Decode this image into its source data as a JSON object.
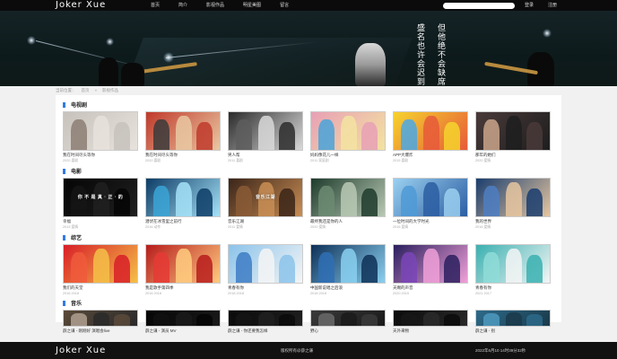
{
  "header": {
    "logo": "Joker Xue",
    "nav": [
      "首页",
      "简介",
      "影视作品",
      "明星美图",
      "留言"
    ],
    "search_placeholder": "",
    "login": "登录",
    "register": "注册"
  },
  "banner": {
    "poem_right": [
      "但",
      "他",
      "都",
      "不",
      "会",
      "缺",
      "席"
    ],
    "poem_columns": [
      "但他绝不会缺席",
      "盛名也许会迟到"
    ]
  },
  "breadcrumb": [
    "当前位置：",
    "首页",
    "»",
    "影视作品"
  ],
  "sections": [
    {
      "title": "电视剧",
      "items": [
        {
          "title": "我在时间尽头等你",
          "meta": "2020    喜剧",
          "colors": [
            "#c7c2bc",
            "#8c7e74",
            "#e7e2dc"
          ],
          "cap": ""
        },
        {
          "title": "我在时间尽头等你",
          "meta": "2020    喜剧",
          "colors": [
            "#c0392b",
            "#3b3b3b",
            "#e9c8a2"
          ],
          "cap": ""
        },
        {
          "title": "男人帮",
          "meta": "2011    喜剧",
          "colors": [
            "#2b2b2b",
            "#5d5d5d",
            "#d9d9d9"
          ],
          "cap": ""
        },
        {
          "title": "妈妈像花儿一样",
          "meta": "2011    家庭剧",
          "colors": [
            "#e8a0b5",
            "#4aa3d9",
            "#f3e3a1"
          ],
          "cap": ""
        },
        {
          "title": "APP大爆炸",
          "meta": "2015    喜剧",
          "colors": [
            "#f6d32d",
            "#4aa8e6",
            "#e65a3a"
          ],
          "cap": ""
        },
        {
          "title": "那年的她们",
          "meta": "2020    爱情",
          "colors": [
            "#4a3a3a",
            "#caa58a",
            "#1e1e1e"
          ],
          "cap": ""
        }
      ]
    },
    {
      "title": "电影",
      "items": [
        {
          "title": "幸福",
          "meta": "2013    爱情",
          "colors": [
            "#050505",
            "#151515",
            "#202020"
          ],
          "cap": "你 不 是 真 · 正 · 的"
        },
        {
          "title": "潜伏在冰雪里之前行",
          "meta": "2016    动作",
          "colors": [
            "#0d3c66",
            "#3aa4d6",
            "#a5e2f7"
          ],
          "cap": ""
        },
        {
          "title": "音乐江湖",
          "meta": "2011    爱情",
          "colors": [
            "#3a2418",
            "#8a5a36",
            "#c98e55"
          ],
          "cap": "音乐江湖"
        },
        {
          "title": "最终我还是你的人",
          "meta": "2020    爱情",
          "colors": [
            "#1e3b2c",
            "#6c8b72",
            "#b8c9b4"
          ],
          "cap": ""
        },
        {
          "title": "一位时间的大学时光",
          "meta": "2016    爱情",
          "colors": [
            "#9bd0f0",
            "#4d9ad6",
            "#2b5ea2"
          ],
          "cap": ""
        },
        {
          "title": "我的世界",
          "meta": "2016    爱情",
          "colors": [
            "#1a3d6e",
            "#4e7ec2",
            "#e6c6a0"
          ],
          "cap": ""
        }
      ]
    },
    {
      "title": "综艺",
      "items": [
        {
          "title": "我们的天堂",
          "meta": "2016    2018",
          "colors": [
            "#d81e28",
            "#f05a3c",
            "#f4c048"
          ],
          "cap": ""
        },
        {
          "title": "我是歌手第四季",
          "meta": "2016    2018",
          "colors": [
            "#b71c1c",
            "#e53935",
            "#ffcc80"
          ],
          "cap": ""
        },
        {
          "title": "青春有你",
          "meta": "2018    2018",
          "colors": [
            "#8bc3ea",
            "#3d7cc4",
            "#f5f5f5"
          ],
          "cap": ""
        },
        {
          "title": "中国新说唱之后浪",
          "meta": "2018    2018",
          "colors": [
            "#0e3057",
            "#2f6fb5",
            "#8ad0f0"
          ],
          "cap": ""
        },
        {
          "title": "天赐的声音",
          "meta": "2020    2015",
          "colors": [
            "#2a1f5e",
            "#7a45b8",
            "#f0a0d8"
          ],
          "cap": ""
        },
        {
          "title": "青春有你",
          "meta": "2021    2017",
          "colors": [
            "#3ab0b0",
            "#8fdcd8",
            "#f5f5f5"
          ],
          "cap": ""
        }
      ]
    },
    {
      "title": "音乐",
      "items": [
        {
          "title": "薛之谦 - 刚刚好 演唱会live",
          "meta": "",
          "colors": [
            "#5a4a3a",
            "#b0a090",
            "#2a2a2a"
          ],
          "cap": ""
        },
        {
          "title": "薛之谦 - 演员 MV",
          "meta": "",
          "colors": [
            "#050505",
            "#101010",
            "#1a1a1a"
          ],
          "cap": ""
        },
        {
          "title": "薛之谦 - 你还要我怎样",
          "meta": "",
          "colors": [
            "#0a0a0a",
            "#151515",
            "#202020"
          ],
          "cap": ""
        },
        {
          "title": "野心",
          "meta": "",
          "colors": [
            "#3a3a3a",
            "#6a6a6a",
            "#1a1a1a"
          ],
          "cap": ""
        },
        {
          "title": "天外来物",
          "meta": "",
          "colors": [
            "#0a0a0a",
            "#181818",
            "#2a2a2a"
          ],
          "cap": ""
        },
        {
          "title": "薛之谦 - 别",
          "meta": "",
          "colors": [
            "#2d6a8a",
            "#4d9ac0",
            "#1a3a4a"
          ],
          "cap": ""
        }
      ]
    }
  ],
  "footer": {
    "logo": "Joker Xue",
    "copyright": "版权所有@薛之谦",
    "clock": "2022年6月10 14时39分32秒"
  }
}
